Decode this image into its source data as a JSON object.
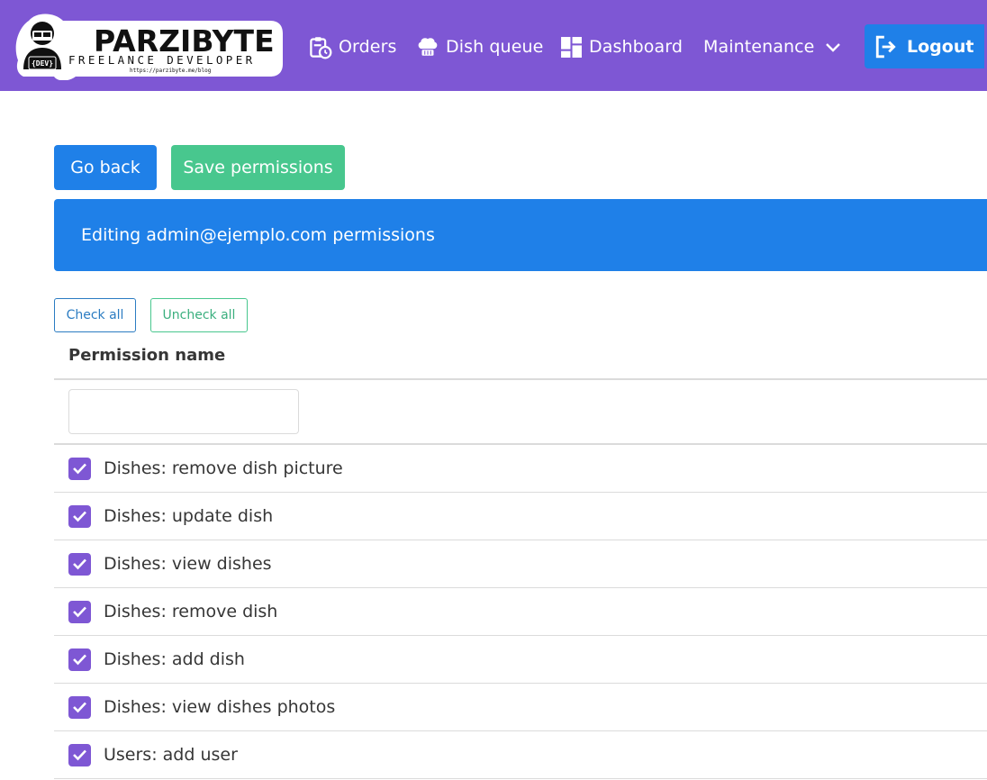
{
  "colors": {
    "navbar": "#7e57d4",
    "primary": "#1f80e8",
    "success": "#48c78e",
    "checkbox": "#7e57d4",
    "border": "#dbdbdb"
  },
  "logo": {
    "title": "PARZIBYTE",
    "subtitle": "FREELANCE DEVELOPER",
    "url": "https://parzibyte.me/blog",
    "badge": "{DEV}"
  },
  "nav": {
    "orders": {
      "label": "Orders",
      "icon": "clipboard-clock-icon"
    },
    "dish_queue": {
      "label": "Dish queue",
      "icon": "chef-hat-icon"
    },
    "dashboard": {
      "label": "Dashboard",
      "icon": "dashboard-icon"
    },
    "maintenance": {
      "label": "Maintenance",
      "icon": "chevron-down-icon"
    },
    "logout": {
      "label": "Logout",
      "icon": "logout-icon"
    }
  },
  "actions": {
    "go_back": "Go back",
    "save_permissions": "Save permissions"
  },
  "banner": {
    "text": "Editing admin@ejemplo.com permissions"
  },
  "bulk": {
    "check_all": "Check all",
    "uncheck_all": "Uncheck all"
  },
  "table": {
    "header": "Permission name",
    "filter_value": "",
    "filter_placeholder": "",
    "rows": [
      {
        "label": "Dishes: remove dish picture",
        "checked": true
      },
      {
        "label": "Dishes: update dish",
        "checked": true
      },
      {
        "label": "Dishes: view dishes",
        "checked": true
      },
      {
        "label": "Dishes: remove dish",
        "checked": true
      },
      {
        "label": "Dishes: add dish",
        "checked": true
      },
      {
        "label": "Dishes: view dishes photos",
        "checked": true
      },
      {
        "label": "Users: add user",
        "checked": true
      }
    ]
  }
}
